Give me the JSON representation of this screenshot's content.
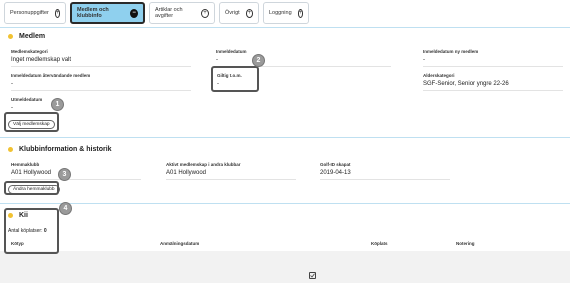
{
  "tabs": [
    {
      "label": "Personuppgifter",
      "icon": "+"
    },
    {
      "label": "Medlem och klubbinfo",
      "icon": "−"
    },
    {
      "label": "Artiklar och avgifter",
      "icon": "+"
    },
    {
      "label": "Övrigt",
      "icon": "+"
    },
    {
      "label": "Loggning",
      "icon": "+"
    }
  ],
  "medlem": {
    "title": "Medlem",
    "medlemskategori_label": "Medlemskategori",
    "medlemskategori_value": "Inget medlemskap valt",
    "inmeldedatum_label": "Inmeldedatum",
    "inmeldedatum_value": "-",
    "inmeldedatum_ny_label": "Inmeldedatum ny medlem",
    "inmeldedatum_ny_value": "-",
    "inmeldedatum_ovr_label": "Inmeldedatum återvändande medlem",
    "inmeldedatum_ovr_value": "-",
    "giltig_label": "Giltig t.o.m.",
    "giltig_value": "-",
    "alderskategori_label": "Alderskategori",
    "alderskategori_value": "SGF-Senior, Senior yngre 22-26",
    "utmeldedatum_label": "Utmeldedatum",
    "utmeldedatum_value": "-",
    "button": "Välj medlemskap"
  },
  "klubb": {
    "title": "Klubbinformation & historik",
    "hemmaklubb_label": "Hemmaklubb",
    "hemmaklubb_value": "A01 Hollywood",
    "aktivt_label": "Aktivt medlemskap i andra klubbar",
    "aktivt_value": "A01 Hollywood",
    "golfid_label": "Golf-ID skapat",
    "golfid_value": "2019-04-13",
    "button": "Ändra hemmaklubb"
  },
  "kii": {
    "title": "Kii",
    "antal_label": "Antal köplatser:",
    "antal_value": "0",
    "columns": [
      "Kötyp",
      "Anmälningsdatum",
      "Köplats",
      "Notering"
    ]
  },
  "callouts": [
    "1",
    "2",
    "3",
    "4"
  ],
  "colors": {
    "accent_tab": "#8fd0ee",
    "dot": "#f1c232",
    "callout": "#9a9a9a"
  }
}
